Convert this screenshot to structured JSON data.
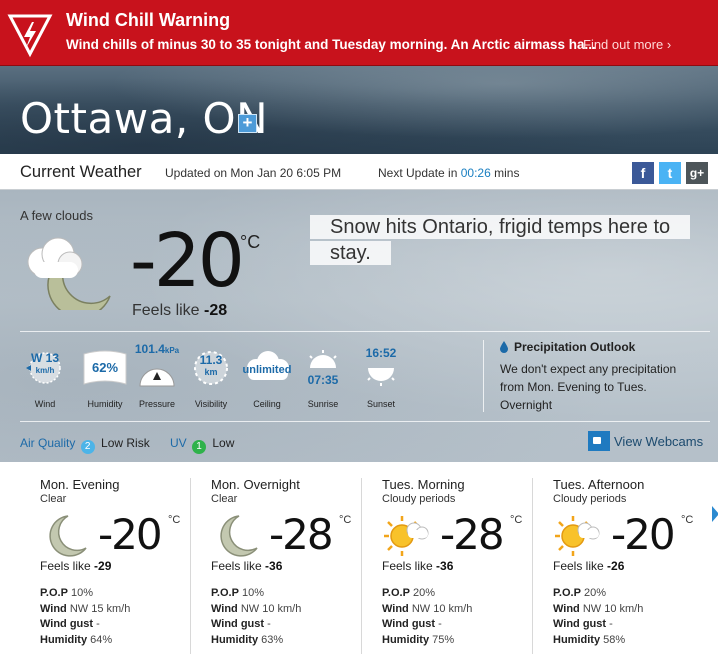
{
  "warning": {
    "title": "Wind Chill Warning",
    "text": "Wind chills of minus 30 to 35 tonight and Tuesday morning. An Arctic airmass ha...",
    "link": "Find out more ›",
    "icon": "lightning-warning-icon"
  },
  "city": {
    "name": "Ottawa, ON",
    "plus": "+"
  },
  "current_bar": {
    "title": "Current Weather",
    "updated": "Updated on Mon Jan 20 6:05 PM",
    "next_update_label": "Next Update in",
    "next_update_time": "00:26",
    "next_update_unit": "mins",
    "social": [
      "f",
      "t",
      "g+"
    ]
  },
  "current": {
    "condition": "A few clouds",
    "temp": "-20",
    "unit": "°C",
    "feels_label": "Feels like",
    "feels_value": "-28",
    "news": "Snow hits Ontario, frigid temps here to stay."
  },
  "metrics": {
    "wind": {
      "value": "W 13",
      "unit": "km/h",
      "label": "Wind"
    },
    "humidity": {
      "value": "62%",
      "label": "Humidity"
    },
    "pressure": {
      "value": "101.4",
      "unit": "kPa",
      "label": "Pressure"
    },
    "visibility": {
      "value": "11.3",
      "unit": "km",
      "label": "Visibility"
    },
    "ceiling": {
      "value": "unlimited",
      "label": "Ceiling"
    },
    "sunrise": {
      "value": "07:35",
      "label": "Sunrise"
    },
    "sunset": {
      "value": "16:52",
      "label": "Sunset"
    }
  },
  "precip": {
    "title": "Precipitation Outlook",
    "text": "We don't expect any precipitation from Mon. Evening to Tues. Overnight"
  },
  "air_quality": {
    "label": "Air Quality",
    "value": "2",
    "risk": "Low Risk",
    "color": "#4cb4e8"
  },
  "uv": {
    "label": "UV",
    "value": "1",
    "risk": "Low",
    "color": "#2fb24a"
  },
  "webcams": {
    "label": "View Webcams"
  },
  "forecast": [
    {
      "period": "Mon. Evening",
      "cond": "Clear",
      "icon": "moon-icon",
      "temp": "-20",
      "unit": "°C",
      "feels": "-29",
      "pop": "10%",
      "wind": "NW 15 km/h",
      "gust": "-",
      "humidity": "64%"
    },
    {
      "period": "Mon. Overnight",
      "cond": "Clear",
      "icon": "moon-icon",
      "temp": "-28",
      "unit": "°C",
      "feels": "-36",
      "pop": "10%",
      "wind": "NW 10 km/h",
      "gust": "-",
      "humidity": "63%"
    },
    {
      "period": "Tues. Morning",
      "cond": "Cloudy periods",
      "icon": "sun-cloud-icon",
      "temp": "-28",
      "unit": "°C",
      "feels": "-36",
      "pop": "20%",
      "wind": "NW 10 km/h",
      "gust": "-",
      "humidity": "75%"
    },
    {
      "period": "Tues. Afternoon",
      "cond": "Cloudy periods",
      "icon": "sun-cloud-icon",
      "temp": "-20",
      "unit": "°C",
      "feels": "-26",
      "pop": "20%",
      "wind": "NW 10 km/h",
      "gust": "-",
      "humidity": "58%"
    }
  ],
  "forecast_labels": {
    "feels": "Feels like",
    "pop": "P.O.P",
    "wind": "Wind",
    "gust": "Wind gust",
    "humidity": "Humidity"
  }
}
